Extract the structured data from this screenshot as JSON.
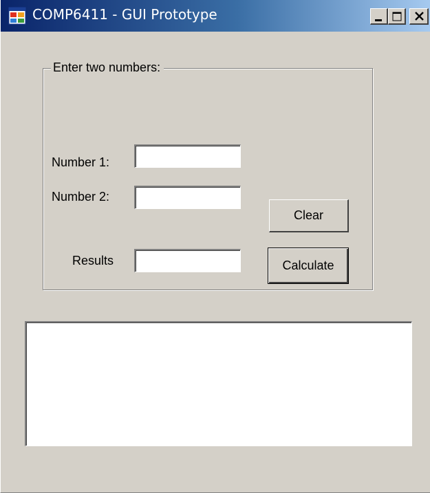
{
  "window": {
    "title": "COMP6411 - GUI Prototype",
    "icon": "windows-form-icon",
    "controls": {
      "minimize_icon": "minimize-icon",
      "maximize_icon": "maximize-icon",
      "close_icon": "close-icon"
    }
  },
  "group": {
    "legend": "Enter two numbers:"
  },
  "fields": {
    "number1": {
      "label": "Number 1:",
      "value": ""
    },
    "number2": {
      "label": "Number 2:",
      "value": ""
    },
    "results": {
      "label": "Results",
      "value": ""
    }
  },
  "buttons": {
    "clear": "Clear",
    "calculate": "Calculate"
  },
  "output": {
    "value": ""
  },
  "colors": {
    "face": "#d4d0c8",
    "titlebar_start": "#0a246a",
    "titlebar_end": "#a6caf0",
    "field_bg": "#ffffff"
  }
}
